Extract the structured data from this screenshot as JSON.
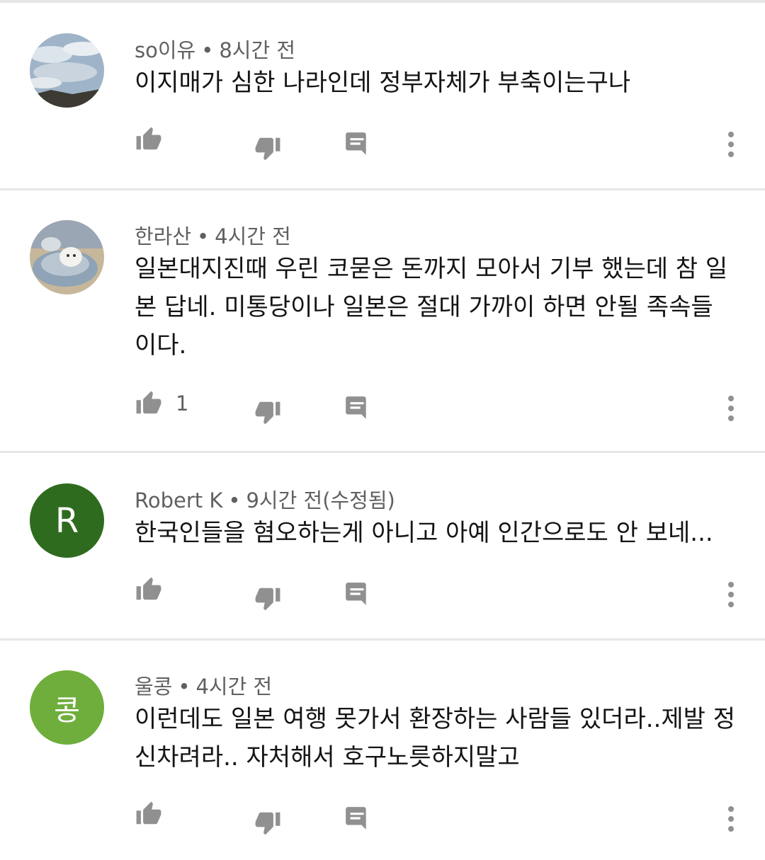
{
  "comments": [
    {
      "author": "so이유",
      "time": "8시간 전",
      "text": "이지매가 심한 나라인데 정부자체가 부축이는구나",
      "likes": "",
      "avatar": {
        "type": "photo",
        "name": "sky-photo-avatar"
      }
    },
    {
      "author": "한라산",
      "time": "4시간 전",
      "text": "일본대지진때 우린 코묻은 돈까지 모아서 기부 했는데 참 일본 답네. 미통당이나 일본은 절대 가까이 하면 안될 족속들이다.",
      "likes": "1",
      "avatar": {
        "type": "photo",
        "name": "dog-photo-avatar"
      }
    },
    {
      "author": "Robert K",
      "time": "9시간 전(수정됨)",
      "text": "한국인들을 혐오하는게 아니고 아예 인간으로도 안 보네...",
      "likes": "",
      "avatar": {
        "type": "letter",
        "letter": "R",
        "color": "#2e6b1f"
      }
    },
    {
      "author": "울콩",
      "time": "4시간 전",
      "text": "이런데도 일본 여행 못가서 환장하는 사람들 있더라..제발 정신차려라.. 자처해서 호구노릇하지말고",
      "likes": "",
      "avatar": {
        "type": "letter",
        "letter": "콩",
        "color": "#6fae3c"
      }
    }
  ],
  "colors": {
    "icon": "#909090",
    "divider": "#e6e6e6",
    "meta": "#606060"
  }
}
